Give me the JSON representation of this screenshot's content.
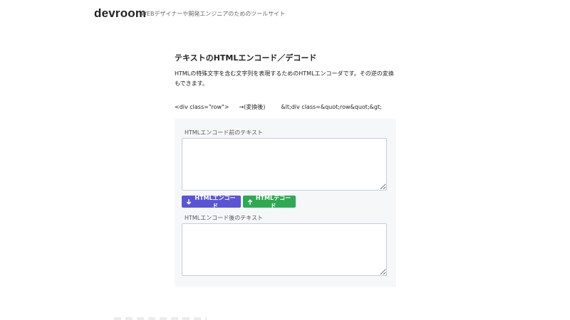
{
  "header": {
    "brand": "devroom",
    "tagline": "WEBデザイナーや開発エンジニアのためのツールサイト"
  },
  "main": {
    "title": "テキストのHTMLエンコード／デコード",
    "description": "HTMLの特殊文字を含む文字列を表現するためのHTMLエンコーダです。その逆の変換もできます。",
    "example": {
      "before": "<div class=\"row\">",
      "arrow": "→(変換後)",
      "after": "&lt;div class=&quot;row&quot;&gt;"
    }
  },
  "form": {
    "input_label": "HTMLエンコード前のテキスト",
    "input_value": "",
    "encode_button": "HTMLエンコード",
    "decode_button": "HTMLデコード",
    "output_label": "HTMLエンコード後のテキスト",
    "output_value": "",
    "colors": {
      "encode": "#5a55d6",
      "decode": "#2eaa52",
      "panel": "#f6f7f9"
    },
    "icons": {
      "encode": "arrow-down-icon",
      "decode": "arrow-up-icon"
    }
  }
}
